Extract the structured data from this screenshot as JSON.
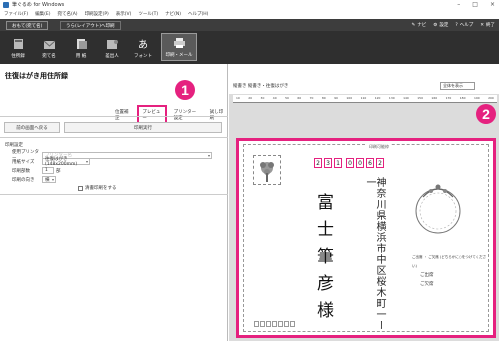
{
  "window": {
    "title": "筆ぐるめ for Windows",
    "controls": [
      "–",
      "□",
      "×"
    ]
  },
  "menu": [
    "ファイル(F)",
    "編集(E)",
    "宛て名(A)",
    "印刷設定(P)",
    "表示(V)",
    "ツール(T)",
    "ナビ(N)",
    "ヘルプ(H)"
  ],
  "tabs": {
    "omote": "おもて(宛て名)",
    "ura": "うら(レイアウト)へ印刷"
  },
  "top_links": {
    "navi": "ナビ",
    "settings": "設定",
    "help": "ヘルプ",
    "exit": "終了"
  },
  "toolbar": [
    "住所録",
    "宛て名",
    "用 紙",
    "差出人",
    "フォント",
    "印刷・メール"
  ],
  "left_panel": {
    "title": "往復はがき用住所録",
    "subtabs": [
      "位置補正",
      "プレビュー",
      "プリンター設定",
      "試し印刷"
    ],
    "back_button": "前の画面へ戻る",
    "print_button": "印刷実行",
    "settings_header": "印刷設定",
    "settings": {
      "printer_label": "使用プリンター",
      "printer_value": "プリンター名",
      "size_label": "用紙サイズ",
      "size_value": "往復はがき (148x200mm)",
      "copies_label": "印刷部数",
      "copies_value": "1",
      "copies_unit": "部",
      "orientation_label": "印刷の向き",
      "orientation_value": "横",
      "clean_print_label": "清書印刷をする"
    }
  },
  "markers": {
    "m1": "1",
    "m2": "2"
  },
  "right_panel": {
    "title": "縦書き 縦書き・往復はがき",
    "zoom_value": "全体を表示",
    "ruler_labels": [
      "10",
      "20",
      "30",
      "40",
      "50",
      "60",
      "70",
      "80",
      "90",
      "100",
      "110",
      "120",
      "130",
      "140",
      "150",
      "160",
      "170",
      "180",
      "190",
      "200"
    ]
  },
  "postcard": {
    "label": "印刷可能枠",
    "zip_digits": [
      "2",
      "3",
      "1",
      "0",
      "0",
      "6",
      "2"
    ],
    "address": "神奈川県横浜市中区桜木町一ー一",
    "name": "富士筆彦様",
    "reply_lines": [
      "ご出席 ・ ご欠席 (どちらかに○をつけてください)",
      "ご出席",
      "ご欠席"
    ]
  },
  "colors": {
    "accent": "#e5217f",
    "dark_toolbar": "#2f2f2f"
  }
}
